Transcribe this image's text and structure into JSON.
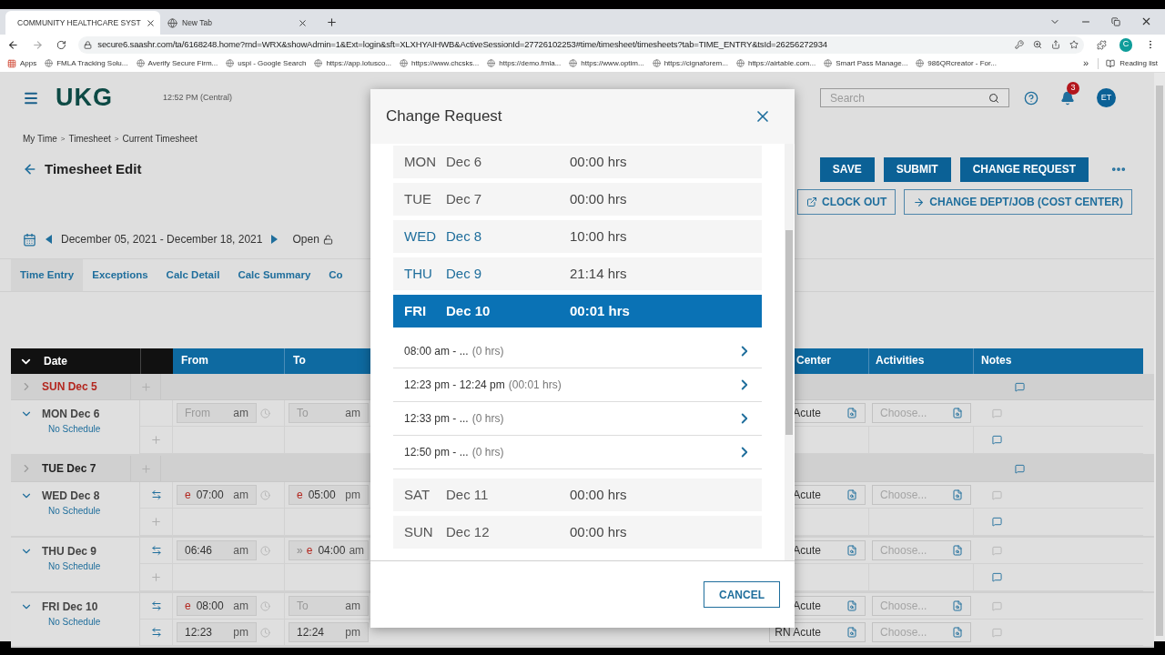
{
  "browser": {
    "tabs": [
      {
        "title": "COMMUNITY HEALTHCARE SYST",
        "selected": true
      },
      {
        "title": "New Tab",
        "selected": false
      }
    ],
    "url": "secure6.saashr.com/ta/6168248.home?rnd=WRX&showAdmin=1&Ext=login&sft=XLXHYAIHWB&ActiveSessionId=27726102253#time/timesheet/timesheets?tab=TIME_ENTRY&tsId=26256272934",
    "bookmarks": [
      "Apps",
      "FMLA Tracking Solu...",
      "Averify Secure Firm...",
      "uspi - Google Search",
      "https://app.lotusco...",
      "https://www.chcsks...",
      "https://demo.fmla...",
      "https://www.optim...",
      "https://cignaforem...",
      "https://airtable.com...",
      "Smart Pass Manage...",
      "986QRcreator - For..."
    ],
    "bookmarks_more": "»",
    "reading_list": "Reading list",
    "profile": "C"
  },
  "header": {
    "logo": "UKG",
    "time": "12:52 PM (Central)",
    "search": {
      "placeholder": "Search"
    },
    "notifications": "3",
    "avatar": "ET"
  },
  "breadcrumb": {
    "items": [
      "My Time",
      "Timesheet",
      "Current Timesheet"
    ],
    "separator": ">"
  },
  "title": "Timesheet Edit",
  "actions": [
    "SAVE",
    "SUBMIT",
    "CHANGE REQUEST"
  ],
  "secondary_actions": [
    {
      "label": "CLOCK OUT",
      "kind": "clock"
    },
    {
      "label": "CHANGE DEPT/JOB (COST CENTER)",
      "kind": "transfer"
    }
  ],
  "period": {
    "range": "December 05, 2021 - December 18, 2021",
    "status": "Open"
  },
  "tabs": [
    {
      "label": "Time Entry",
      "selected": true
    },
    {
      "label": "Exceptions",
      "selected": false
    },
    {
      "label": "Calc Detail",
      "selected": false
    },
    {
      "label": "Calc Summary",
      "selected": false
    },
    {
      "label": "Co",
      "selected": false
    }
  ],
  "table": {
    "columns": {
      "date": "Date",
      "from": "From",
      "to": "To",
      "cost_center": "Center",
      "activities": "Activities",
      "notes": "Notes"
    },
    "days": [
      {
        "label": "SUN Dec 5",
        "expanded": false,
        "weekend": true,
        "note": true
      },
      {
        "label": "MON Dec 6",
        "expanded": true,
        "weekend": false,
        "schedule": "No Schedule",
        "lines": [
          {
            "kind": "punch",
            "swap": false,
            "from": {
              "placeholder": "From",
              "suffix": "am"
            },
            "to": {
              "placeholder": "To",
              "suffix": "am"
            },
            "cost_center": "Acute",
            "activities": {
              "placeholder": "Choose..."
            },
            "note": false
          },
          {
            "kind": "add",
            "note": true
          }
        ]
      },
      {
        "label": "TUE Dec 7",
        "expanded": false,
        "weekend": false,
        "note": true
      },
      {
        "label": "WED Dec 8",
        "expanded": true,
        "weekend": false,
        "schedule": "No Schedule",
        "lines": [
          {
            "kind": "punch",
            "swap": true,
            "from": {
              "prefix": "e",
              "value": "07:00",
              "suffix": "am"
            },
            "to": {
              "prefix": "e",
              "value": "05:00",
              "suffix": "pm"
            },
            "cost_center": "Acute",
            "activities": {
              "placeholder": "Choose..."
            },
            "note": false
          },
          {
            "kind": "add",
            "note": true
          }
        ]
      },
      {
        "label": "THU Dec 9",
        "expanded": true,
        "weekend": false,
        "schedule": "No Schedule",
        "lines": [
          {
            "kind": "punch",
            "swap": true,
            "from": {
              "value": "06:46",
              "suffix": "am"
            },
            "to": {
              "late": "»",
              "prefix": "e",
              "value": "04:00",
              "suffix": "am"
            },
            "cost_center": "Acute",
            "activities": {
              "placeholder": "Choose..."
            },
            "note": false
          },
          {
            "kind": "add",
            "note": true
          }
        ]
      },
      {
        "label": "FRI Dec 10",
        "expanded": true,
        "weekend": false,
        "schedule": "No Schedule",
        "lines": [
          {
            "kind": "punch",
            "swap": true,
            "from": {
              "prefix": "e",
              "value": "08:00",
              "suffix": "am"
            },
            "to": {
              "placeholder": "To",
              "suffix": "am"
            },
            "cost_center": "Acute",
            "activities": {
              "placeholder": "Choose..."
            },
            "note": false
          },
          {
            "kind": "punch",
            "swap": true,
            "from": {
              "value": "12:23",
              "suffix": "pm"
            },
            "to": {
              "value": "12:24",
              "suffix": "pm"
            },
            "cost_center": "RN Acute",
            "activities": {
              "placeholder": "Choose..."
            },
            "note": false
          }
        ]
      }
    ]
  },
  "dialog": {
    "title": "Change Request",
    "cancel": "CANCEL",
    "days": [
      {
        "day": "MON",
        "date": "Dec 6",
        "hours": "00:00 hrs",
        "worked": false,
        "selected": false
      },
      {
        "day": "TUE",
        "date": "Dec 7",
        "hours": "00:00 hrs",
        "worked": false,
        "selected": false
      },
      {
        "day": "WED",
        "date": "Dec 8",
        "hours": "10:00 hrs",
        "worked": true,
        "selected": false
      },
      {
        "day": "THU",
        "date": "Dec 9",
        "hours": "21:14 hrs",
        "worked": true,
        "selected": false
      },
      {
        "day": "FRI",
        "date": "Dec 10",
        "hours": "00:01 hrs",
        "worked": true,
        "selected": true,
        "entries": [
          {
            "range": "08:00 am - ...",
            "duration": "(0 hrs)"
          },
          {
            "range": "12:23 pm - 12:24 pm",
            "duration": "(00:01 hrs)"
          },
          {
            "range": "12:33 pm - ...",
            "duration": "(0 hrs)"
          },
          {
            "range": "12:50 pm - ...",
            "duration": "(0 hrs)"
          }
        ]
      },
      {
        "day": "SAT",
        "date": "Dec 11",
        "hours": "00:00 hrs",
        "worked": false,
        "selected": false
      },
      {
        "day": "SUN",
        "date": "Dec 12",
        "hours": "00:00 hrs",
        "worked": false,
        "selected": false
      }
    ]
  }
}
